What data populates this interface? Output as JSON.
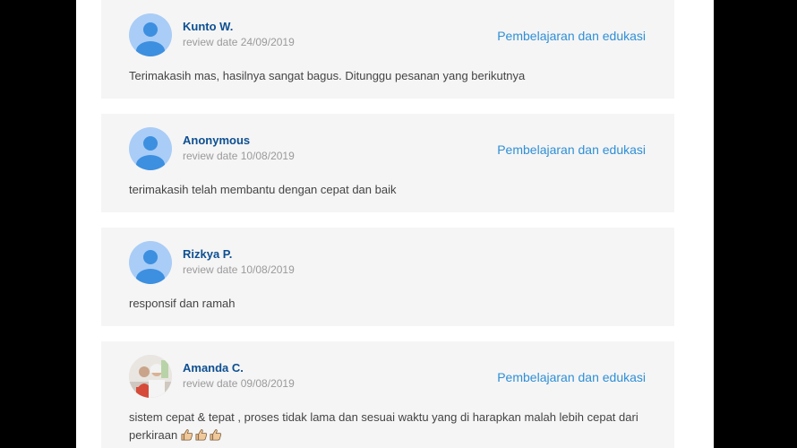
{
  "reviews": [
    {
      "name": "Kunto W.",
      "date": "review date 24/09/2019",
      "category": "Pembelajaran dan edukasi",
      "text": "Terimakasih mas, hasilnya sangat bagus. Ditunggu pesanan yang berikutnya",
      "avatar": "default-avatar-icon"
    },
    {
      "name": "Anonymous",
      "date": "review date 10/08/2019",
      "category": "Pembelajaran dan edukasi",
      "text": "terimakasih telah membantu dengan cepat dan baik",
      "avatar": "default-avatar-icon"
    },
    {
      "name": "Rizkya P.",
      "date": "review date 10/08/2019",
      "category": "",
      "text": "responsif dan ramah",
      "avatar": "default-avatar-icon"
    },
    {
      "name": "Amanda C.",
      "date": "review date 09/08/2019",
      "category": "Pembelajaran dan edukasi",
      "text": "sistem cepat & tepat , proses tidak lama dan sesuai waktu yang di harapkan malah lebih cepat dari perkiraan",
      "avatar": "user-photo",
      "emoji": "thumbs-up-icon x3"
    }
  ],
  "colors": {
    "name": "#0d4f91",
    "category": "#2f8fd6",
    "card_bg": "#f5f5f5",
    "avatar_bg": "#bcd8f7",
    "avatar_fg": "#3d8fe0"
  }
}
